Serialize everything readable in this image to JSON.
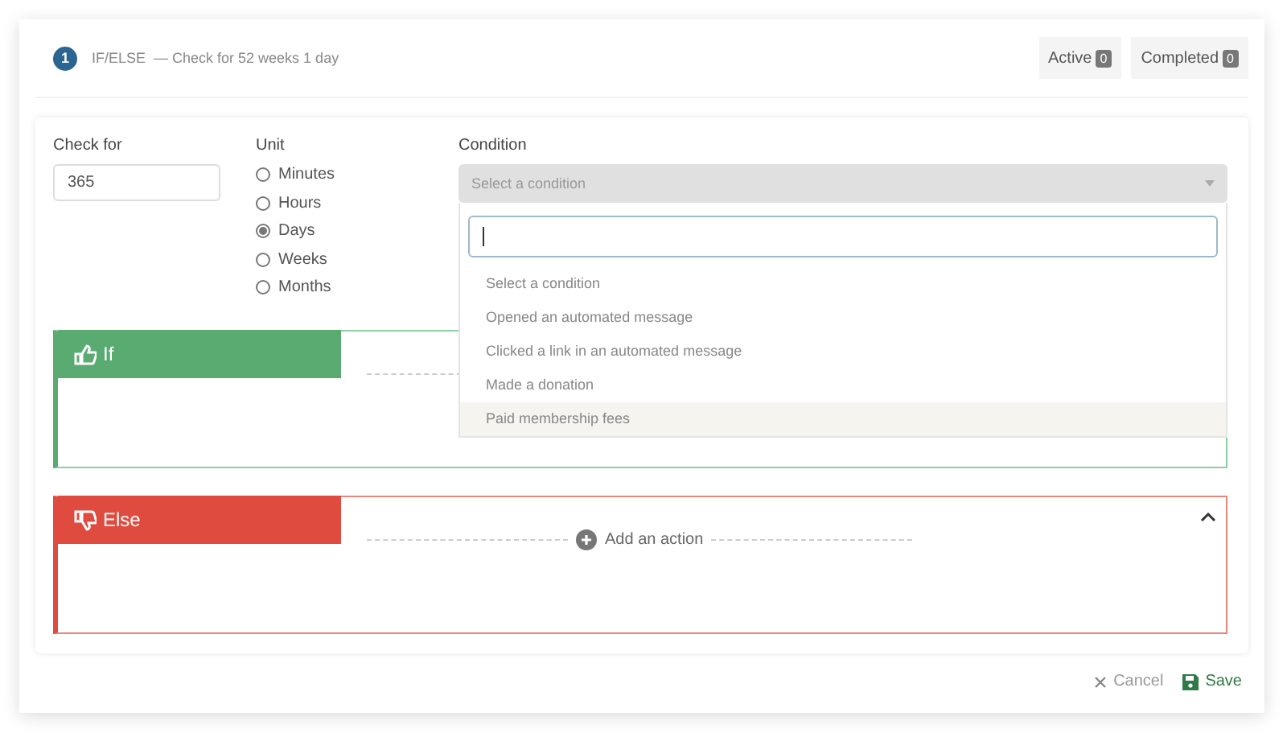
{
  "header": {
    "step": "1",
    "title": "IF/ELSE",
    "summary": "— Check for 52 weeks 1 day",
    "counters": [
      {
        "label": "Active",
        "count": "0"
      },
      {
        "label": "Completed",
        "count": "0"
      }
    ]
  },
  "form": {
    "check_for": {
      "label": "Check for",
      "value": "365"
    },
    "unit": {
      "label": "Unit",
      "options": [
        {
          "label": "Minutes",
          "selected": false
        },
        {
          "label": "Hours",
          "selected": false
        },
        {
          "label": "Days",
          "selected": true
        },
        {
          "label": "Weeks",
          "selected": false
        },
        {
          "label": "Months",
          "selected": false
        }
      ]
    },
    "condition": {
      "label": "Condition",
      "placeholder": "Select a condition",
      "open": true,
      "options": [
        {
          "label": "Select a condition",
          "highlighted": false
        },
        {
          "label": "Opened an automated message",
          "highlighted": false
        },
        {
          "label": "Clicked a link in an automated message",
          "highlighted": false
        },
        {
          "label": "Made a donation",
          "highlighted": false
        },
        {
          "label": "Paid membership fees",
          "highlighted": true
        }
      ]
    }
  },
  "branches": [
    {
      "kind": "if",
      "label": "If"
    },
    {
      "kind": "else",
      "label": "Else",
      "action": "Add an action"
    }
  ],
  "footer": {
    "cancel": "Cancel",
    "save": "Save"
  }
}
